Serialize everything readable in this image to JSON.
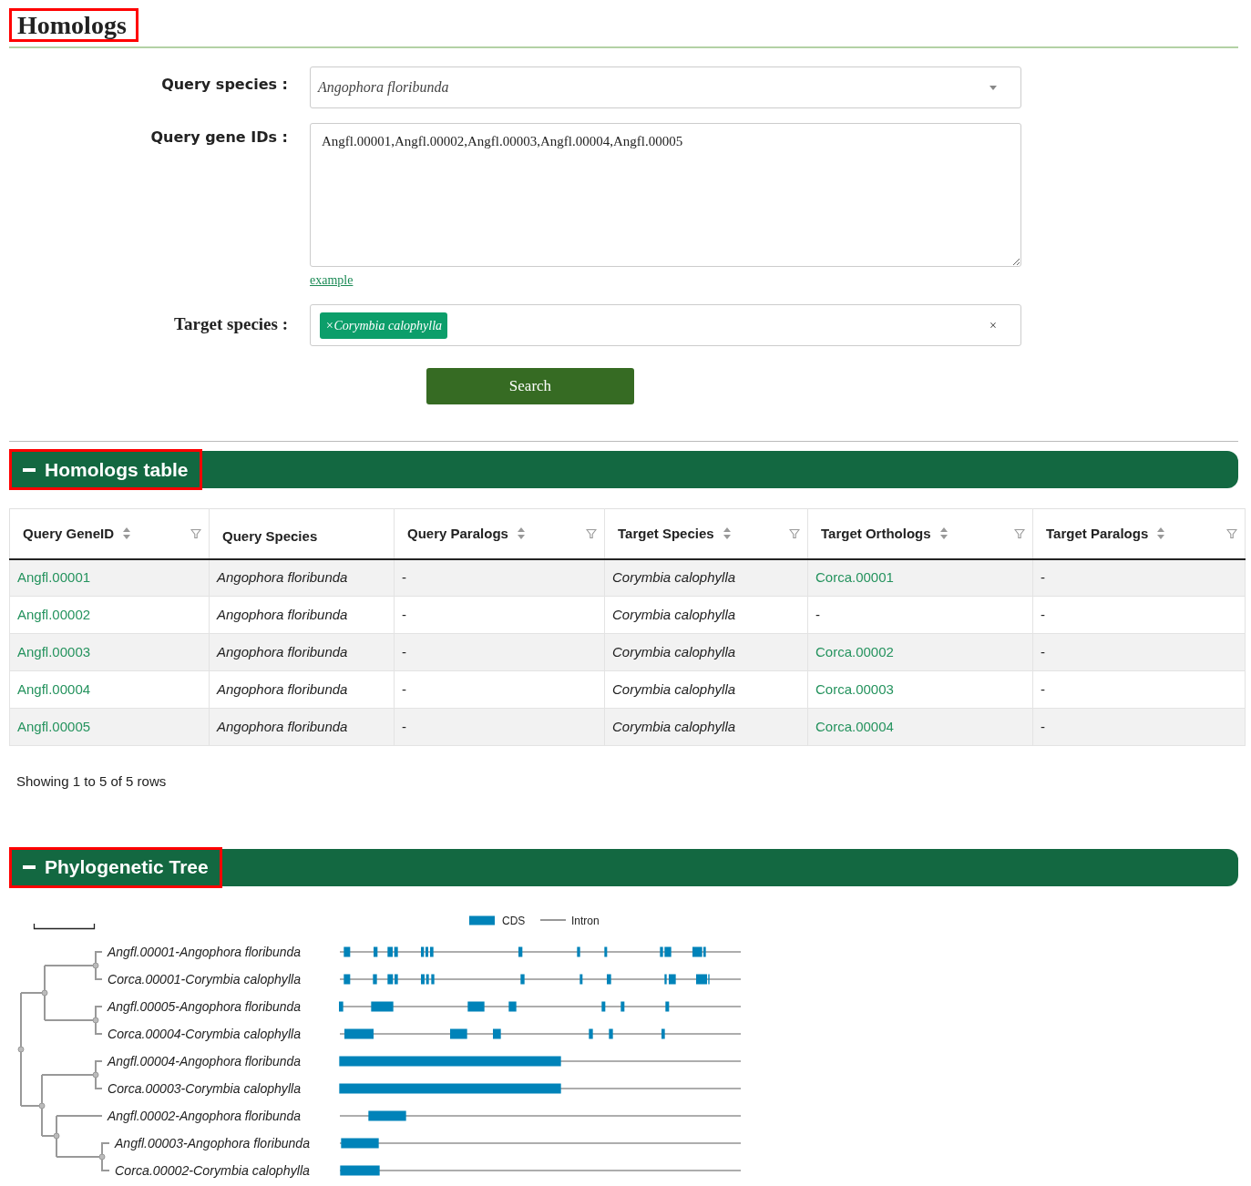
{
  "page_title": "Homologs",
  "form": {
    "query_species": {
      "label": "Query species :",
      "value": "Angophora floribunda"
    },
    "query_gene_ids": {
      "label": "Query gene IDs :",
      "value": "Angfl.00001,Angfl.00002,Angfl.00003,Angfl.00004,Angfl.00005"
    },
    "example_link": "example",
    "target_species": {
      "label": "Target species :",
      "tags": [
        {
          "remove": "×",
          "label": "Corymbia calophylla"
        }
      ],
      "clear": "×"
    },
    "search_button": "Search"
  },
  "homologs_table": {
    "title": "Homologs table",
    "columns": [
      {
        "label": "Query GeneID",
        "sortable": true,
        "filterable": true,
        "italic": false
      },
      {
        "label": "Query Species",
        "sortable": false,
        "filterable": false,
        "italic": true
      },
      {
        "label": "Query Paralogs",
        "sortable": true,
        "filterable": true,
        "italic": false
      },
      {
        "label": "Target Species",
        "sortable": true,
        "filterable": true,
        "italic": true
      },
      {
        "label": "Target Orthologs",
        "sortable": true,
        "filterable": true,
        "italic": false
      },
      {
        "label": "Target Paralogs",
        "sortable": true,
        "filterable": true,
        "italic": false
      }
    ],
    "rows": [
      [
        {
          "text": "Angfl.00001",
          "link": true
        },
        {
          "text": "Angophora floribunda",
          "link": false
        },
        {
          "text": "-",
          "link": false
        },
        {
          "text": "Corymbia calophylla",
          "link": false
        },
        {
          "text": "Corca.00001",
          "link": true
        },
        {
          "text": "-",
          "link": false
        }
      ],
      [
        {
          "text": "Angfl.00002",
          "link": true
        },
        {
          "text": "Angophora floribunda",
          "link": false
        },
        {
          "text": "-",
          "link": false
        },
        {
          "text": "Corymbia calophylla",
          "link": false
        },
        {
          "text": "-",
          "link": false
        },
        {
          "text": "-",
          "link": false
        }
      ],
      [
        {
          "text": "Angfl.00003",
          "link": true
        },
        {
          "text": "Angophora floribunda",
          "link": false
        },
        {
          "text": "-",
          "link": false
        },
        {
          "text": "Corymbia calophylla",
          "link": false
        },
        {
          "text": "Corca.00002",
          "link": true
        },
        {
          "text": "-",
          "link": false
        }
      ],
      [
        {
          "text": "Angfl.00004",
          "link": true
        },
        {
          "text": "Angophora floribunda",
          "link": false
        },
        {
          "text": "-",
          "link": false
        },
        {
          "text": "Corymbia calophylla",
          "link": false
        },
        {
          "text": "Corca.00003",
          "link": true
        },
        {
          "text": "-",
          "link": false
        }
      ],
      [
        {
          "text": "Angfl.00005",
          "link": true
        },
        {
          "text": "Angophora floribunda",
          "link": false
        },
        {
          "text": "-",
          "link": false
        },
        {
          "text": "Corymbia calophylla",
          "link": false
        },
        {
          "text": "Corca.00004",
          "link": true
        },
        {
          "text": "-",
          "link": false
        }
      ]
    ],
    "footer": "Showing 1 to 5 of 5 rows"
  },
  "phylogenetic_tree": {
    "title": "Phylogenetic Tree",
    "legend": [
      {
        "kind": "cds",
        "label": "CDS"
      },
      {
        "kind": "intron",
        "label": "Intron"
      }
    ],
    "leaves": [
      "Angfl.00001-Angophora floribunda",
      "Corca.00001-Corymbia calophylla",
      "Angfl.00005-Angophora floribunda",
      "Corca.00004-Corymbia calophylla",
      "Angfl.00004-Angophora floribunda",
      "Corca.00003-Corymbia calophylla",
      "Angfl.00002-Angophora floribunda",
      "Angfl.00003-Angophora floribunda",
      "Corca.00002-Corymbia calophylla"
    ]
  }
}
